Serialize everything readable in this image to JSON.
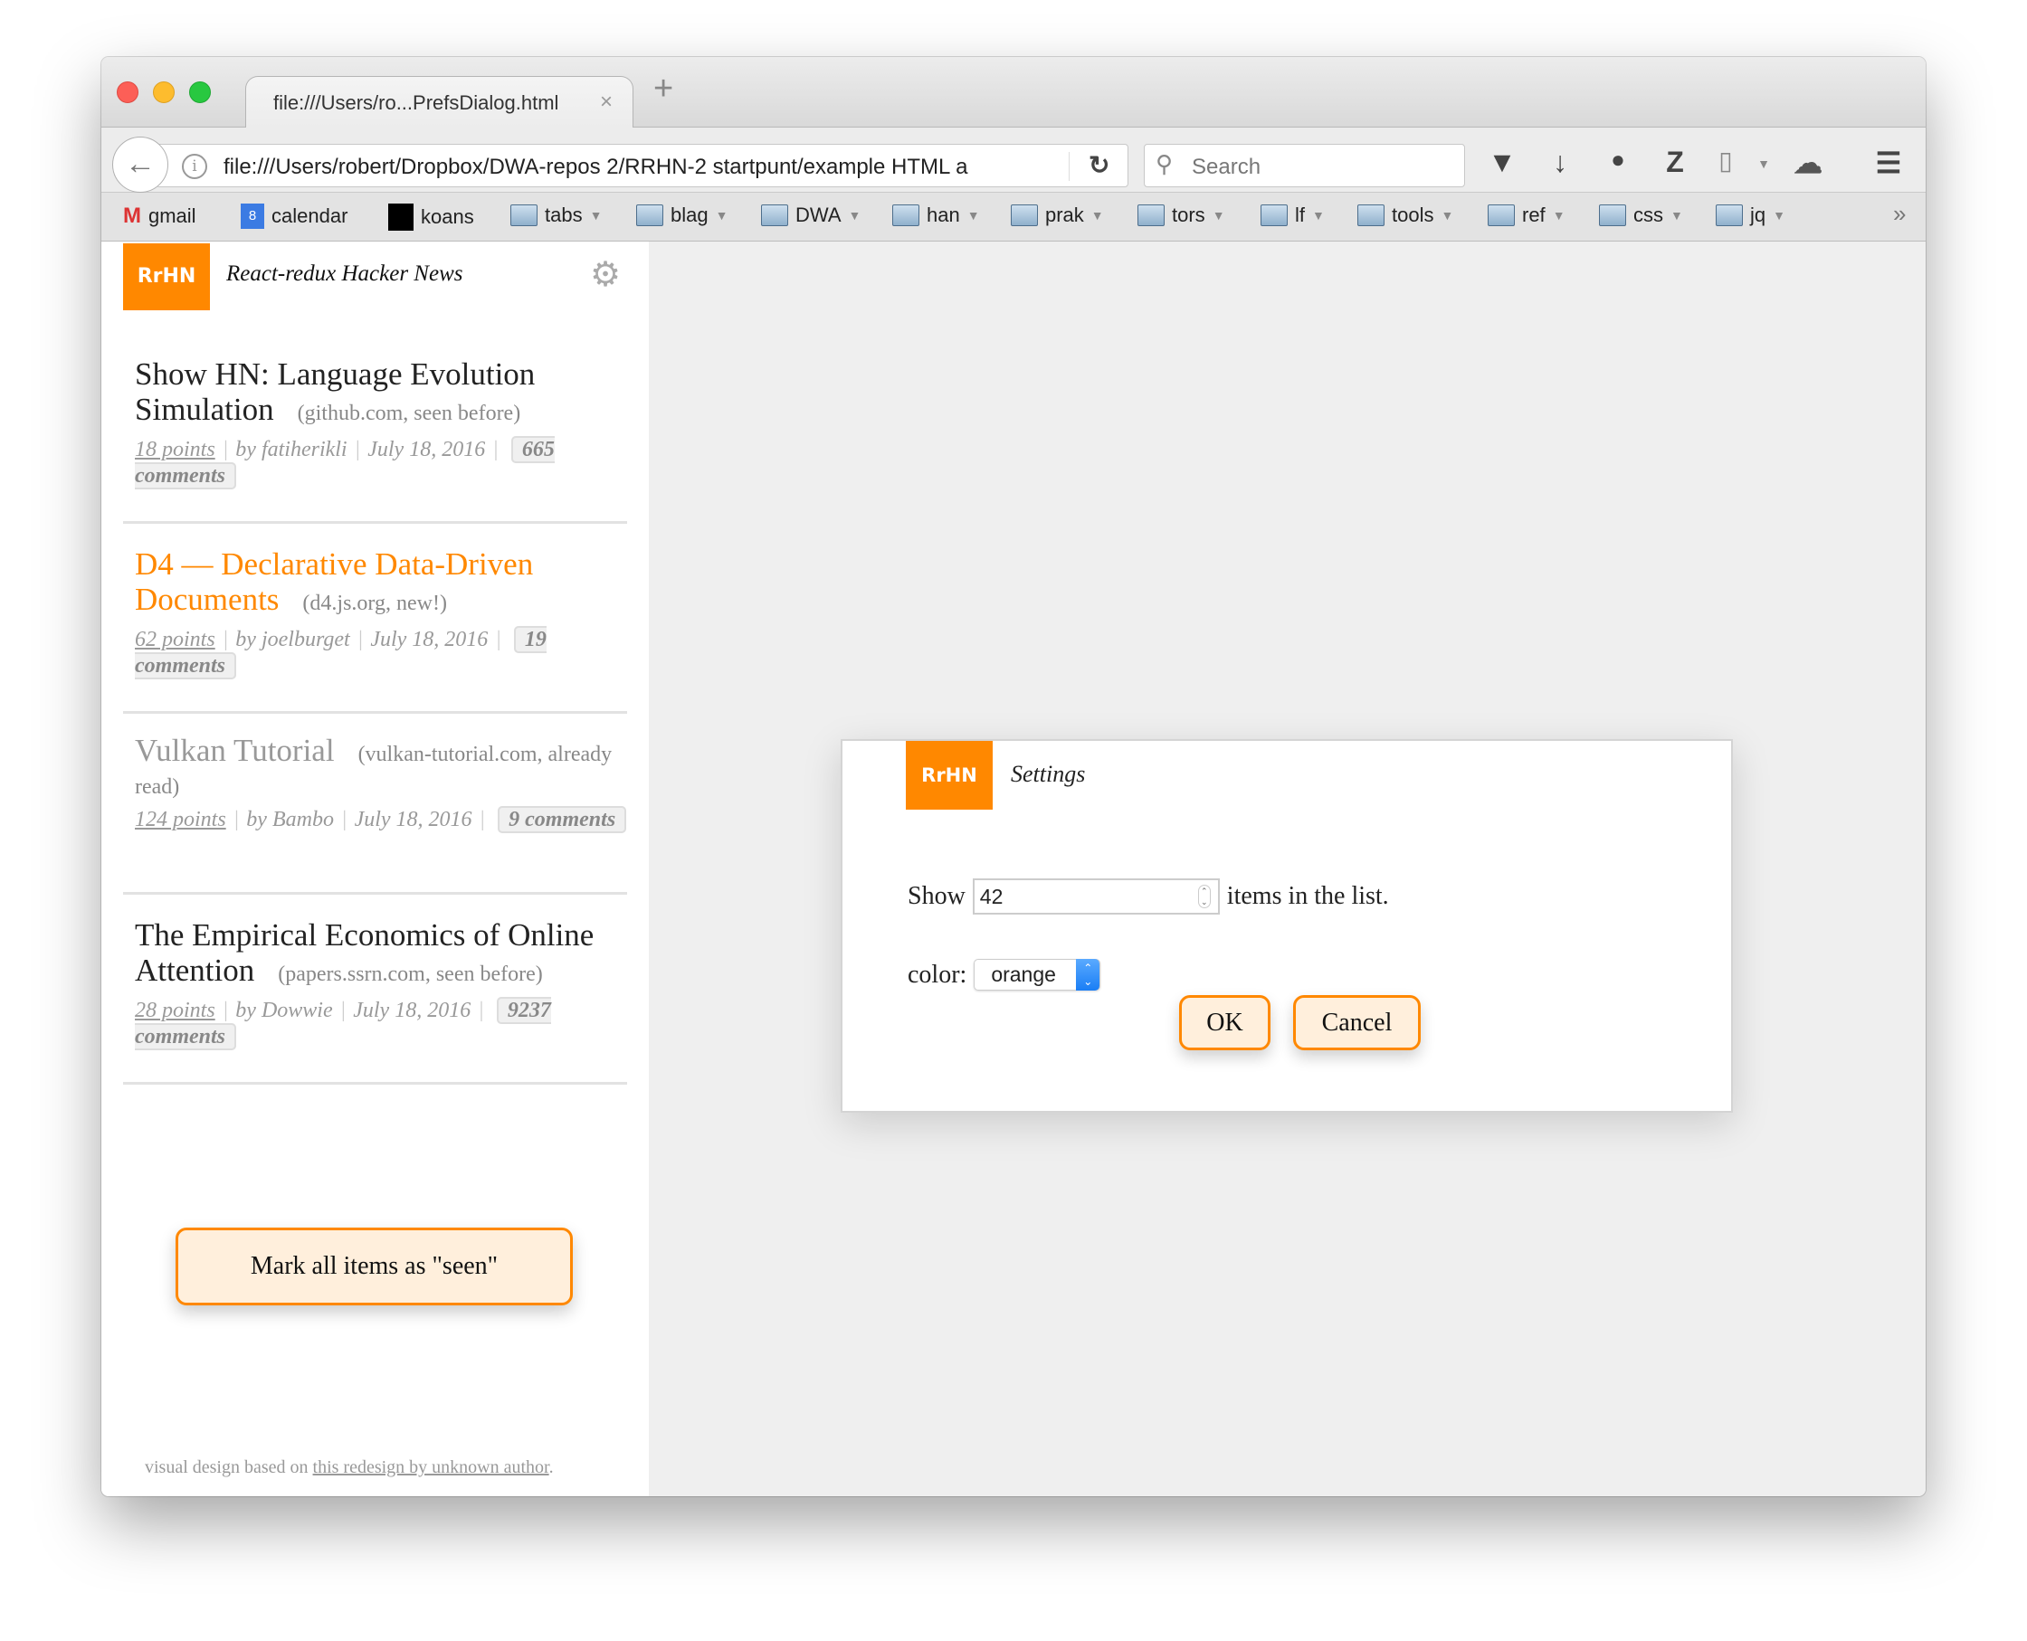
{
  "browser": {
    "tab_title": "file:///Users/ro...PrefsDialog.html",
    "tab_close": "×",
    "new_tab": "+",
    "url": "file:///Users/robert/Dropbox/DWA-repos 2/RRHN-2 startpunt/example HTML a",
    "search_placeholder": "Search",
    "bookmarks": [
      {
        "label": "gmail",
        "icon": "gmail-icon"
      },
      {
        "label": "calendar",
        "icon": "calendar-icon",
        "badge": "8"
      },
      {
        "label": "koans",
        "icon": "koans-icon"
      },
      {
        "label": "tabs",
        "icon": "folder-icon"
      },
      {
        "label": "blag",
        "icon": "folder-icon"
      },
      {
        "label": "DWA",
        "icon": "folder-icon"
      },
      {
        "label": "han",
        "icon": "folder-icon"
      },
      {
        "label": "prak",
        "icon": "folder-icon"
      },
      {
        "label": "tors",
        "icon": "folder-icon"
      },
      {
        "label": "lf",
        "icon": "folder-icon"
      },
      {
        "label": "tools",
        "icon": "folder-icon"
      },
      {
        "label": "ref",
        "icon": "folder-icon"
      },
      {
        "label": "css",
        "icon": "folder-icon"
      },
      {
        "label": "jq",
        "icon": "folder-icon"
      }
    ]
  },
  "app": {
    "logo": "RrHN",
    "title": "React-redux Hacker News",
    "accent": "#ff8800",
    "items": [
      {
        "title": "Show HN: Language Evolution Simulation",
        "domain": "(github.com, seen before)",
        "points": "18 points",
        "by": "by fatiherikli",
        "date": "July 18, 2016",
        "comments": "665",
        "comments_label": "comments",
        "state": "seen"
      },
      {
        "title": "D4 — Declarative Data-Driven Documents",
        "domain": "(d4.js.org, new!)",
        "points": "62 points",
        "by": "by joelburget",
        "date": "July 18, 2016",
        "comments": "19",
        "comments_label": "comments",
        "state": "new"
      },
      {
        "title": "Vulkan Tutorial",
        "domain": "(vulkan-tutorial.com, already read)",
        "points": "124 points",
        "by": "by Bambo",
        "date": "July 18, 2016",
        "comments": "9",
        "comments_label": "comments",
        "state": "read"
      },
      {
        "title": "The Empirical Economics of Online Attention",
        "domain": "(papers.ssrn.com, seen before)",
        "points": "28 points",
        "by": "by Dowwie",
        "date": "July 18, 2016",
        "comments": "9237",
        "comments_label": "comments",
        "state": "seen"
      }
    ],
    "mark_all_button": "Mark all items as \"seen\"",
    "footer_prefix": "visual design based on ",
    "footer_link": "this redesign by unknown author",
    "footer_suffix": "."
  },
  "dialog": {
    "logo": "RrHN",
    "title": "Settings",
    "show_label": "Show",
    "count_value": "42",
    "items_suffix": "items in the list.",
    "color_label": "color:",
    "color_value": "orange",
    "ok": "OK",
    "cancel": "Cancel"
  }
}
